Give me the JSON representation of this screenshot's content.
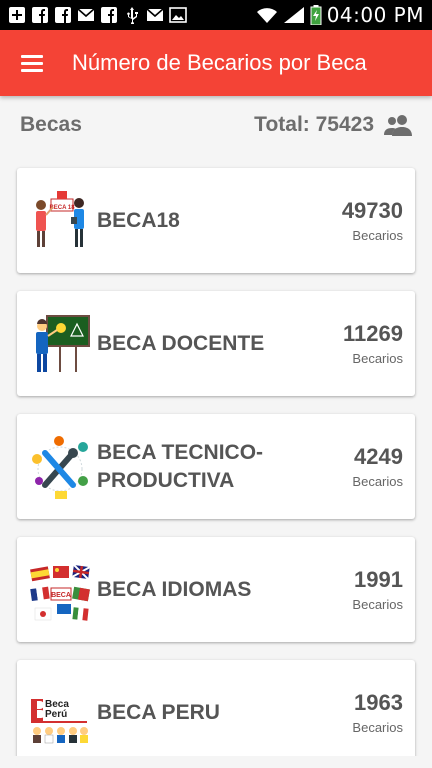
{
  "status_bar": {
    "time": "04:00 PM",
    "icons": [
      "plus-box-icon",
      "facebook-icon",
      "facebook-icon",
      "gmail-icon",
      "facebook-icon",
      "usb-icon",
      "gmail-icon",
      "image-icon",
      "wifi-icon",
      "signal-icon",
      "battery-charging-icon"
    ]
  },
  "app_bar": {
    "menu_icon": "menu-icon",
    "title": "Número de Becarios por Beca",
    "color": "#f44336"
  },
  "summary": {
    "label": "Becas",
    "total": "Total: 75423",
    "icon": "people-icon"
  },
  "becas": [
    {
      "name": "BECA18",
      "count": "49730",
      "count_label": "Becarios",
      "image": "beca18-illustration"
    },
    {
      "name": "BECA DOCENTE",
      "count": "11269",
      "count_label": "Becarios",
      "image": "teacher-illustration"
    },
    {
      "name": "BECA TECNICO-PRODUCTIVA",
      "count": "4249",
      "count_label": "Becarios",
      "image": "tools-illustration"
    },
    {
      "name": "BECA IDIOMAS",
      "count": "1991",
      "count_label": "Becarios",
      "image": "flags-illustration"
    },
    {
      "name": "BECA PERU",
      "count": "1963",
      "count_label": "Becarios",
      "image": "beca-peru-logo"
    }
  ],
  "images_text": {
    "beca18_sign": "BECA 18",
    "idiomas_sign": "BECA",
    "peru_logo_line1": "Beca",
    "peru_logo_line2": "Perú"
  }
}
